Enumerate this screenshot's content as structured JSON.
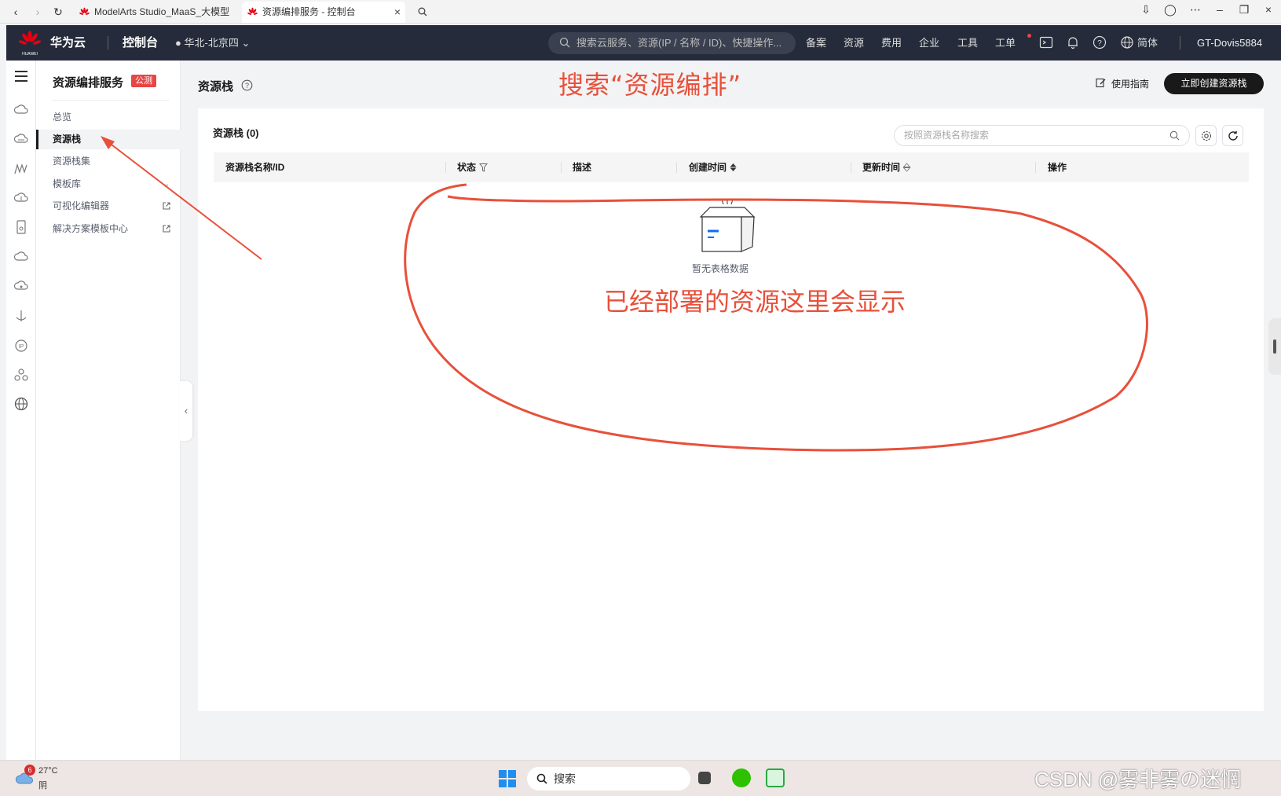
{
  "browser": {
    "tabs": [
      {
        "label": "ModelArts Studio_MaaS_大模型"
      },
      {
        "label": "资源编排服务 - 控制台"
      }
    ]
  },
  "topnav": {
    "brand": "华为云",
    "console": "控制台",
    "region": "华北-北京四",
    "search_placeholder": "搜索云服务、资源(IP / 名称 / ID)、快捷操作...",
    "links": [
      "备案",
      "资源",
      "费用",
      "企业",
      "工具",
      "工单"
    ],
    "language": "简体",
    "user": "GT-Dovis5884"
  },
  "sidebar": {
    "title": "资源编排服务",
    "badge": "公测",
    "items": [
      {
        "label": "总览"
      },
      {
        "label": "资源栈"
      },
      {
        "label": "资源栈集"
      },
      {
        "label": "模板库"
      },
      {
        "label": "可视化编辑器"
      },
      {
        "label": "解决方案模板中心"
      }
    ]
  },
  "main": {
    "title": "资源栈",
    "guide": "使用指南",
    "create_button": "立即创建资源栈",
    "card_title": "资源栈 (0)",
    "search_placeholder": "按照资源栈名称搜索",
    "columns": [
      "资源栈名称/ID",
      "状态",
      "描述",
      "创建时间",
      "更新时间",
      "操作"
    ],
    "empty_text": "暂无表格数据"
  },
  "annotations": {
    "title": "搜索“资源编排”",
    "note": "已经部署的资源这里会显示"
  },
  "taskbar": {
    "weather_badge": "6",
    "temperature": "27°C",
    "condition": "阴",
    "search": "搜索",
    "watermark": "CSDN @雾非雾の迷惘"
  },
  "colors": {
    "nav_bg": "#252b3a",
    "annotation": "#e8503a",
    "accent_button": "#191919",
    "brand_red": "#e84545"
  }
}
